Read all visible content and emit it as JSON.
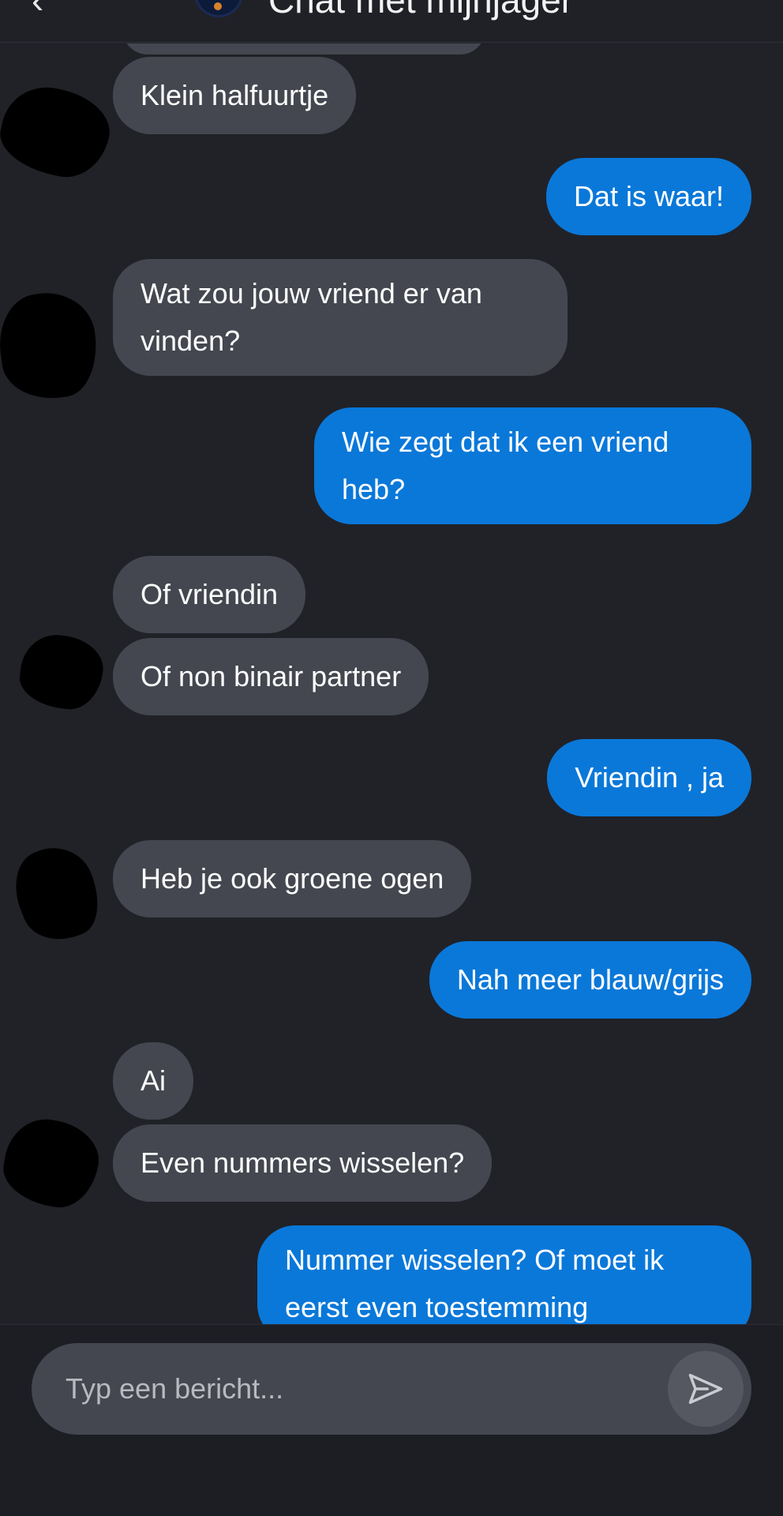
{
  "header": {
    "back_icon": "chevron-left-icon",
    "title": "Chat met mijnjager"
  },
  "messages": [
    {
      "from": "them",
      "text": "Klein halfuurtje"
    },
    {
      "from": "me",
      "text": "Dat is waar!"
    },
    {
      "from": "them",
      "text": "Wat zou jouw vriend er van vinden?"
    },
    {
      "from": "me",
      "text": "Wie zegt dat ik een vriend heb?"
    },
    {
      "from": "them",
      "text": "Of vriendin"
    },
    {
      "from": "them",
      "text": "Of non binair partner"
    },
    {
      "from": "me",
      "text": "Vriendin , ja"
    },
    {
      "from": "them",
      "text": "Heb je ook groene ogen"
    },
    {
      "from": "me",
      "text": "Nah meer blauw/grijs"
    },
    {
      "from": "them",
      "text": "Ai"
    },
    {
      "from": "them",
      "text": "Even nummers wisselen?"
    },
    {
      "from": "me",
      "text": "Nummer wisselen? Of moet ik eerst even toestemming"
    }
  ],
  "composer": {
    "placeholder": "Typ een bericht...",
    "send_icon": "send-icon"
  },
  "colors": {
    "background": "#202228",
    "incoming_bubble": "#44474f",
    "outgoing_bubble": "#0a78d9",
    "text": "#ffffff"
  }
}
